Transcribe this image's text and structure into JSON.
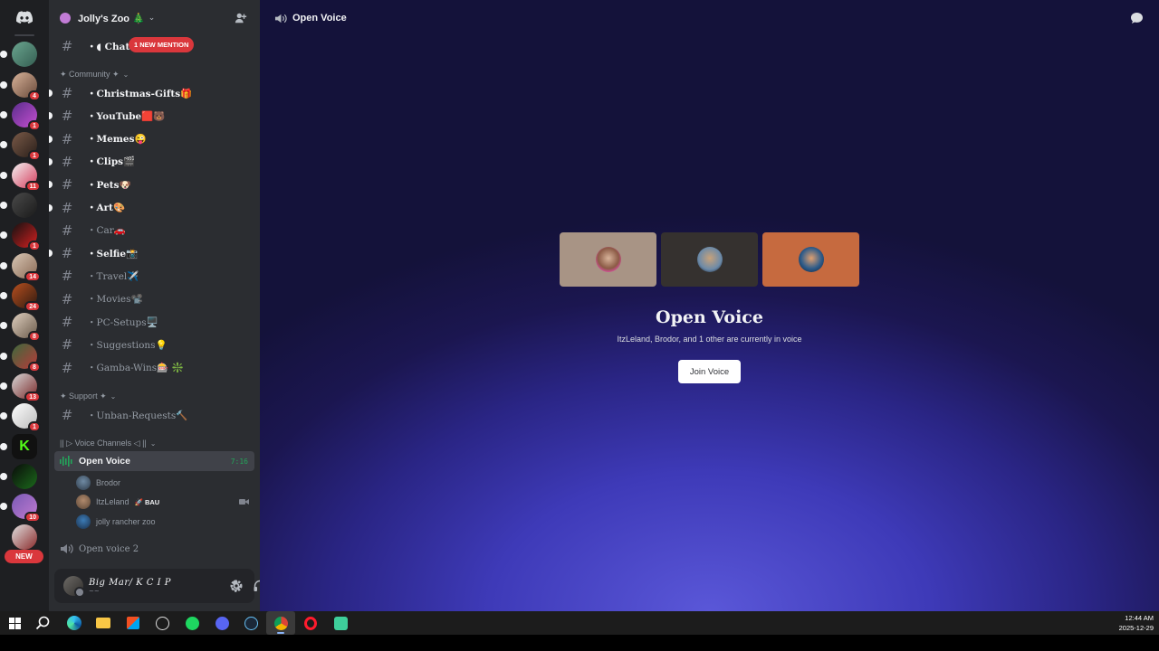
{
  "server": {
    "name": "Jolly's Zoo 🎄",
    "rail_badges": [
      "",
      "4",
      "1",
      "1",
      "11",
      "",
      "1",
      "14",
      "24",
      "8",
      "8",
      "13",
      "1",
      "",
      "",
      "10",
      ""
    ],
    "new_label": "NEW"
  },
  "channels": {
    "chat": {
      "name": "・◖ Chat",
      "mention": "1 NEW MENTION"
    },
    "category_community": "✦ Community ✦",
    "community": [
      {
        "name": "・Christmas-Gifts🎁",
        "unread": true
      },
      {
        "name": "・YouTube🟥🐻",
        "unread": true
      },
      {
        "name": "・Memes😜",
        "unread": true
      },
      {
        "name": "・Clips🎬",
        "unread": true
      },
      {
        "name": "・Pets🐶",
        "unread": true
      },
      {
        "name": "・Art🎨",
        "unread": true
      },
      {
        "name": "・Car🚗",
        "unread": false
      },
      {
        "name": "・Selfie📸",
        "unread": true
      },
      {
        "name": "・Travel✈️",
        "unread": false
      },
      {
        "name": "・Movies📽️",
        "unread": false
      },
      {
        "name": "・PC-Setups🖥️",
        "unread": false
      },
      {
        "name": "・Suggestions💡",
        "unread": false
      },
      {
        "name": "・Gamba-Wins🎰 ❇️",
        "unread": false
      }
    ],
    "category_support": "✦ Support ✦",
    "support": [
      {
        "name": "・Unban-Requests🔨",
        "unread": false
      }
    ],
    "category_voice": "|| ▷ Voice Channels ◁ ||",
    "voice_active": {
      "name": "Open Voice",
      "time": "7:16"
    },
    "voice_users": [
      {
        "name": "Brodor",
        "tag": ""
      },
      {
        "name": "ItzLeland",
        "tag": "🚀 BAU"
      },
      {
        "name": "jolly rancher zoo",
        "tag": ""
      }
    ],
    "voice2": "Open voice 2"
  },
  "user_panel": {
    "display": "Big Mar/ K C I P",
    "status": "~~"
  },
  "main": {
    "channel_title": "Open Voice",
    "heading": "Open Voice",
    "subtitle": "ItzLeland, Brodor, and 1 other are currently in voice",
    "join_label": "Join Voice",
    "tile_colors": [
      "#a89485",
      "#35312f",
      "#c66a3f"
    ]
  },
  "taskbar": {
    "time": "12:44 AM",
    "date": "2025-12-29"
  },
  "colors": {
    "accent_red": "#da373c",
    "voice_green": "#23a55a",
    "blurple": "#5865f2"
  }
}
